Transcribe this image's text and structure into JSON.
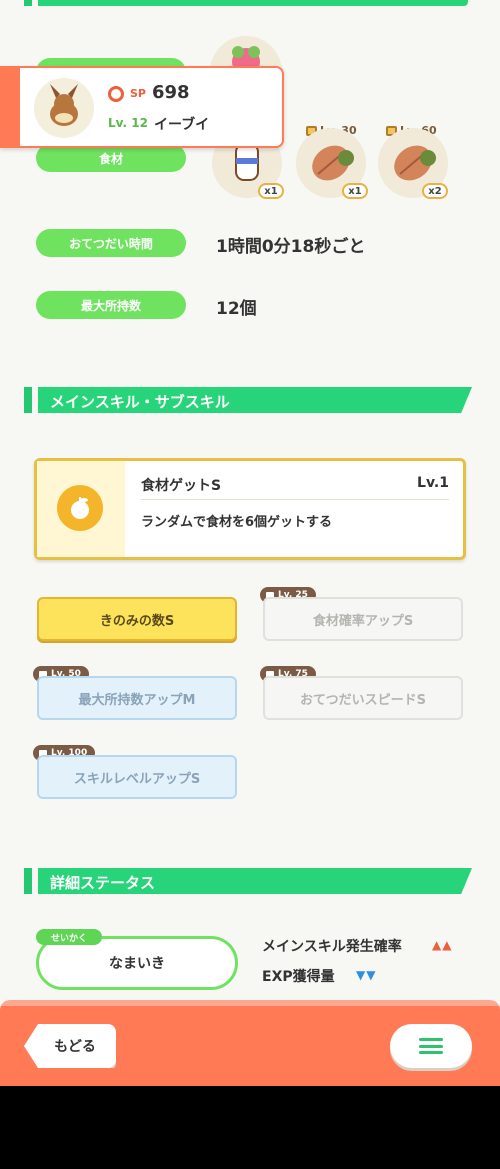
{
  "pokemon_card": {
    "sp_label": "SP",
    "sp_value": "698",
    "level": "Lv. 12",
    "name": "イーブイ"
  },
  "ingredients": {
    "label": "食材",
    "unlocks": [
      {
        "level": "Lv. 30",
        "qty": "x1"
      },
      {
        "level": "Lv. 60",
        "qty": "x2"
      }
    ],
    "first_qty": "x1"
  },
  "help_time": {
    "label": "おてつだい時間",
    "value": "1時間0分18秒ごと"
  },
  "max_carry": {
    "label": "最大所持数",
    "value": "12個"
  },
  "skills_section": {
    "title": "メインスキル・サブスキル"
  },
  "main_skill": {
    "name": "食材ゲットS",
    "level": "Lv.1",
    "description": "ランダムで食材を6個ゲットする"
  },
  "sub_skills": [
    {
      "label": "きのみの数S",
      "lock": ""
    },
    {
      "label": "食材確率アップS",
      "lock": "Lv. 25"
    },
    {
      "label": "最大所持数アップM",
      "lock": "Lv. 50"
    },
    {
      "label": "おてつだいスピードS",
      "lock": "Lv. 75"
    },
    {
      "label": "スキルレベルアップS",
      "lock": "Lv. 100"
    }
  ],
  "detail_section": {
    "title": "詳細ステータス"
  },
  "nature": {
    "tag": "せいかく",
    "value": "なまいき",
    "up_effect": "メインスキル発生確率",
    "down_effect": "EXP獲得量",
    "up_arrows": "▲▲",
    "down_arrows": "▼▼"
  },
  "footer": {
    "back_label": "もどる"
  },
  "colors": {
    "accent_green": "#28d47a",
    "label_green": "#6fe35f",
    "footer_orange": "#ff7a55"
  }
}
